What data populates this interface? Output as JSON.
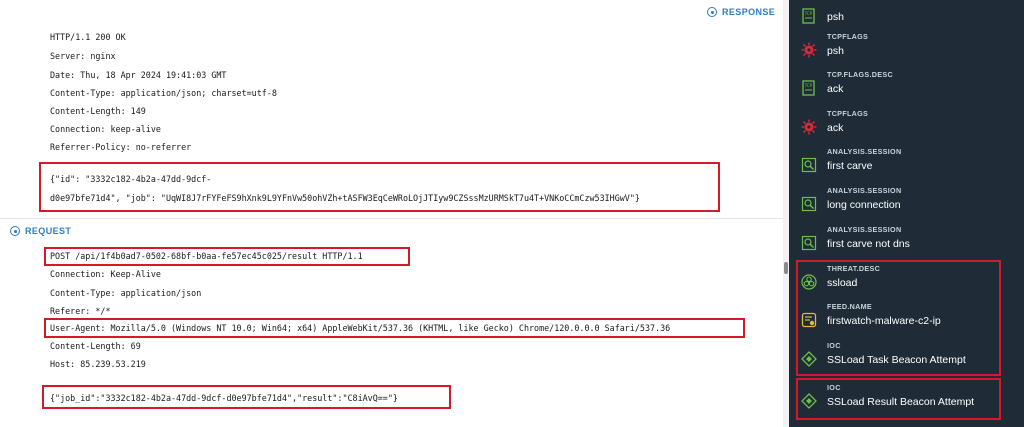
{
  "response": {
    "heading": "RESPONSE",
    "lines": [
      "HTTP/1.1 200 OK",
      "Server: nginx",
      "Date: Thu, 18 Apr 2024 19:41:03 GMT",
      "Content-Type: application/json; charset=utf-8",
      "Content-Length: 149",
      "Connection: keep-alive",
      "Referrer-Policy: no-referrer"
    ],
    "body_line1": "{\"id\": \"3332c182-4b2a-47dd-9dcf-",
    "body_line2": "d0e97bfe71d4\", \"job\": \"UqWI8J7rFYFeFS9hXnk9L9YFnVw50ohVZh+tASFW3EqCeWRoLOjJTIyw9CZSssMzURMSkT7u4T+VNKoCCmCzw53IHGwV\"}"
  },
  "request": {
    "heading": "REQUEST",
    "post_line": "POST /api/1f4b0ad7-0502-68bf-b0aa-fe57ec45c025/result HTTP/1.1",
    "lines": [
      "Connection: Keep-Alive",
      "Content-Type: application/json",
      "Referer: */*"
    ],
    "user_agent": "User-Agent: Mozilla/5.0 (Windows NT 10.0; Win64; x64) AppleWebKit/537.36 (KHTML, like Gecko) Chrome/120.0.0.0 Safari/537.36",
    "lines_after": [
      "Content-Length: 69",
      "Host: 85.239.53.219"
    ],
    "body": "{\"job_id\":\"3332c182-4b2a-47dd-9dcf-d0e97bfe71d4\",\"result\":\"C8iAvQ==\"}"
  },
  "sidebar": {
    "items": [
      {
        "key": "",
        "value": "psh",
        "icon": "tcp-flag-icon"
      },
      {
        "key": "TCPFLAGS",
        "value": "psh",
        "icon": "virus-icon"
      },
      {
        "key": "TCP.FLAGS.DESC",
        "value": "ack",
        "icon": "tcp-flag-icon"
      },
      {
        "key": "TCPFLAGS",
        "value": "ack",
        "icon": "virus-icon"
      },
      {
        "key": "ANALYSIS.SESSION",
        "value": "first carve",
        "icon": "session-analysis-icon"
      },
      {
        "key": "ANALYSIS.SESSION",
        "value": "long connection",
        "icon": "session-analysis-icon"
      },
      {
        "key": "ANALYSIS.SESSION",
        "value": "first carve not dns",
        "icon": "session-analysis-icon"
      },
      {
        "key": "THREAT.DESC",
        "value": "ssload",
        "icon": "biohazard-icon"
      },
      {
        "key": "FEED.NAME",
        "value": "firstwatch-malware-c2-ip",
        "icon": "feed-icon"
      },
      {
        "key": "IOC",
        "value": "SSLoad Task Beacon Attempt",
        "icon": "ioc-diamond-icon"
      },
      {
        "key": "IOC",
        "value": "SSLoad Result Beacon Attempt",
        "icon": "ioc-diamond-icon"
      }
    ]
  },
  "colors": {
    "accent": "#2b7ec9",
    "highlight": "#d11a2a",
    "sidebar_bg": "#1f2c37",
    "icon_green": "#6cc04a",
    "icon_red": "#e0283b",
    "icon_yellow": "#e2b93b"
  }
}
